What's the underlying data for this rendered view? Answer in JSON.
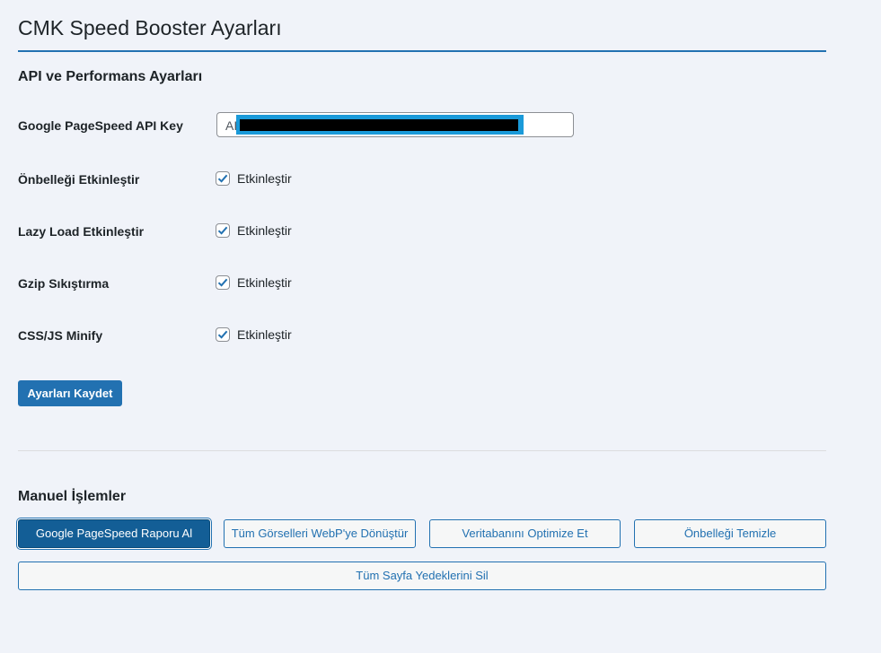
{
  "page": {
    "title": "CMK Speed Booster Ayarları"
  },
  "settings_section": {
    "title": "API ve Performans Ayarları",
    "api_key": {
      "label": "Google PageSpeed API Key",
      "visible_value_prefix": "AI",
      "redacted": true
    },
    "options": [
      {
        "label": "Önbelleği Etkinleştir",
        "checkbox_label": "Etkinleştir",
        "checked": true
      },
      {
        "label": "Lazy Load Etkinleştir",
        "checkbox_label": "Etkinleştir",
        "checked": true
      },
      {
        "label": "Gzip Sıkıştırma",
        "checkbox_label": "Etkinleştir",
        "checked": true
      },
      {
        "label": "CSS/JS Minify",
        "checkbox_label": "Etkinleştir",
        "checked": true
      }
    ],
    "save_button": "Ayarları Kaydet"
  },
  "manual_section": {
    "title": "Manuel İşlemler",
    "buttons": [
      {
        "label": "Google PageSpeed Raporu Al",
        "active": true
      },
      {
        "label": "Tüm Görselleri WebP'ye Dönüştür",
        "active": false
      },
      {
        "label": "Veritabanını Optimize Et",
        "active": false
      },
      {
        "label": "Önbelleği Temizle",
        "active": false
      },
      {
        "label": "Tüm Sayfa Yedeklerini Sil",
        "active": false
      }
    ]
  },
  "colors": {
    "background": "#f0f3f9",
    "accent": "#2271b1",
    "accent_dark": "#135e96",
    "text": "#1d2327"
  },
  "icons": {
    "checkbox_checked": "checkmark-icon"
  }
}
